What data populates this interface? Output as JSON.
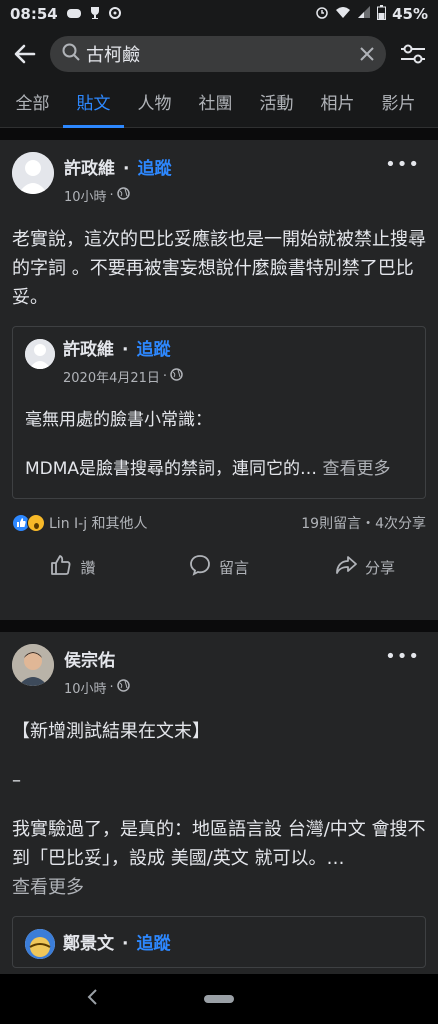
{
  "status": {
    "time": "08:54",
    "battery": "45%"
  },
  "search": {
    "query": "古柯鹼"
  },
  "tabs": [
    "全部",
    "貼文",
    "人物",
    "社團",
    "活動",
    "相片",
    "影片"
  ],
  "posts": [
    {
      "author": "許政維",
      "follow": "追蹤",
      "time": "10小時",
      "text": "老實說，這次的巴比妥應該也是一開始就被禁止搜尋的字詞 。不要再被害妄想說什麼臉書特別禁了巴比妥。",
      "shared": {
        "author": "許政維",
        "follow": "追蹤",
        "time": "2020年4月21日",
        "para1": "毫無用處的臉書小常識：",
        "para2": "MDMA是臉書搜尋的禁詞，連同它的…",
        "see_more": "查看更多"
      },
      "reactions_text": "Lin I-j 和其他人",
      "counts": "19則留言・4次分享",
      "actions": [
        "讚",
        "留言",
        "分享"
      ]
    },
    {
      "author": "侯宗佑",
      "time": "10小時",
      "line1": "【新增測試結果在文末】",
      "line2": "–",
      "line3": "我實驗過了，是真的：地區語言設 台灣/中文 會搜不到「巴比妥」，設成 美國/英文 就可以。…",
      "see_more": "查看更多",
      "shared": {
        "author": "鄭景文",
        "follow": "追蹤"
      }
    }
  ]
}
